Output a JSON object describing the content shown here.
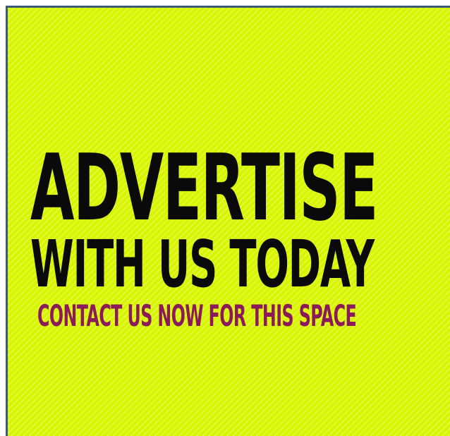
{
  "ad": {
    "line1": "ADVERTISE",
    "line2": "WITH US TODAY",
    "line3": "CONTACT US NOW FOR THIS SPACE"
  },
  "colors": {
    "background": "#d8f500",
    "stripes": "#f0ff80",
    "headline": "#0a0a0a",
    "subline": "#8a1a5a",
    "border": "#3a5a7a"
  }
}
